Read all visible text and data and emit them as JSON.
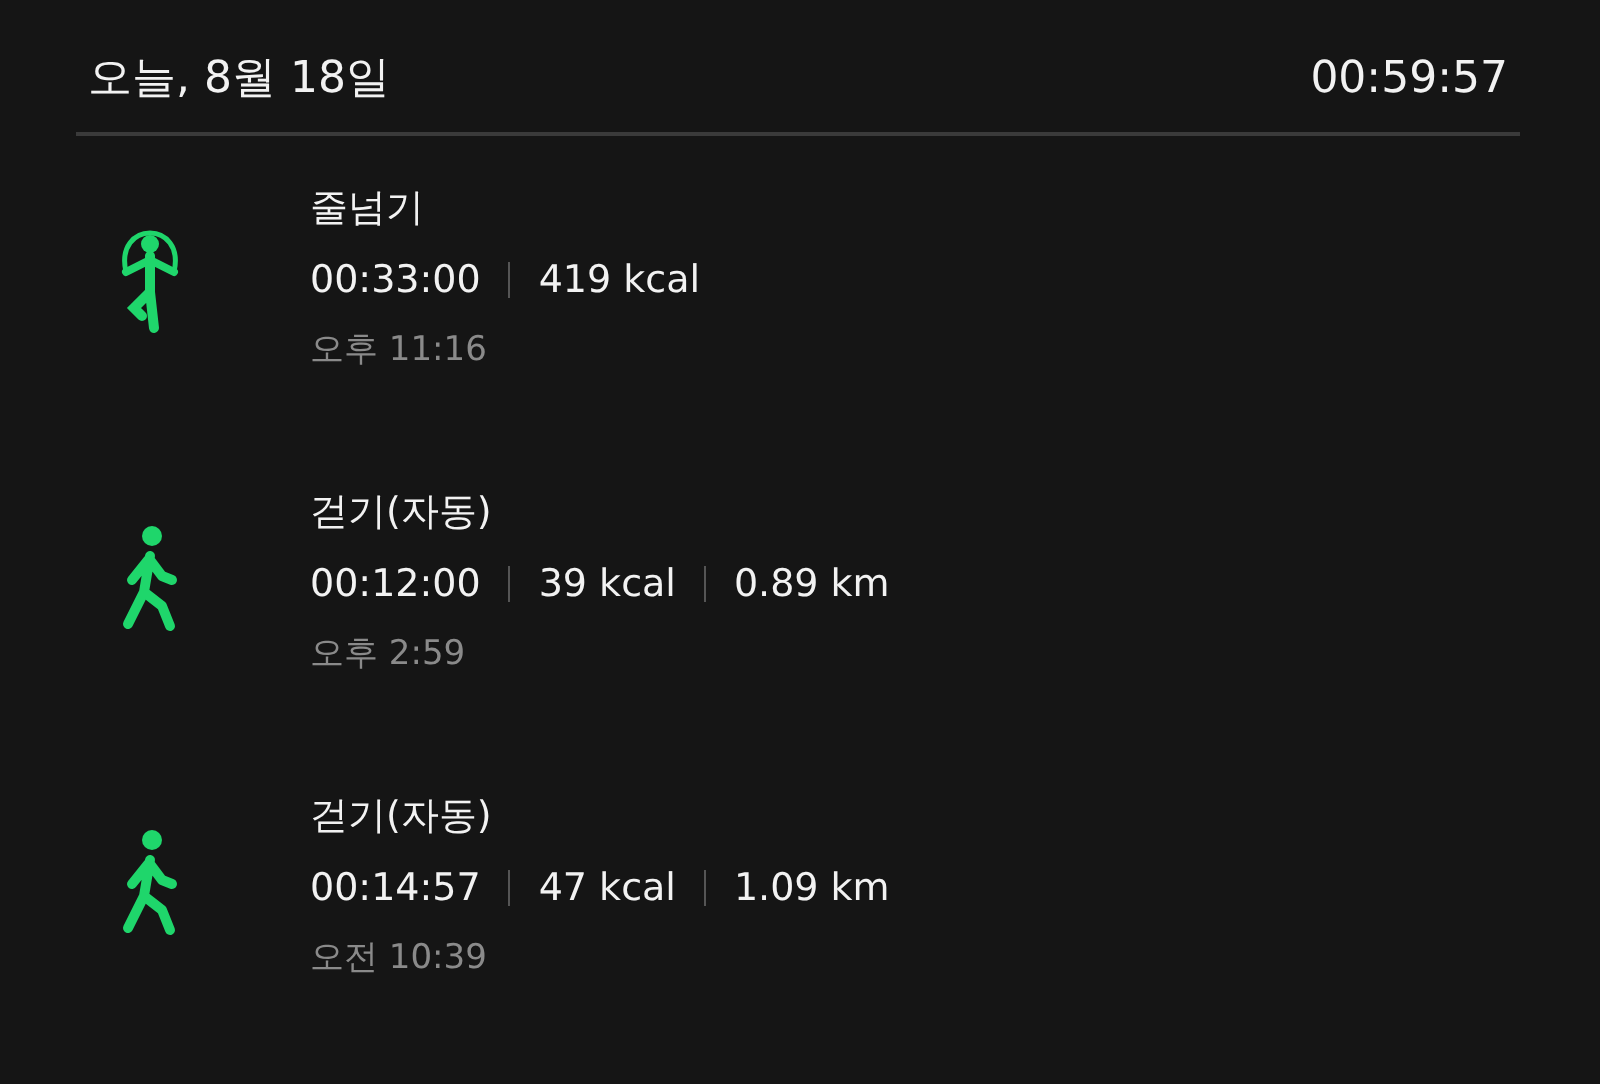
{
  "header": {
    "date": "오늘, 8월 18일",
    "total": "00:59:57"
  },
  "activities": [
    {
      "kind": "jump_rope",
      "name": "줄넘기",
      "stats": [
        "00:33:00",
        "419 kcal"
      ],
      "time": "오후 11:16"
    },
    {
      "kind": "walking",
      "name": "걷기(자동)",
      "stats": [
        "00:12:00",
        "39 kcal",
        "0.89 km"
      ],
      "time": "오후 2:59"
    },
    {
      "kind": "walking",
      "name": "걷기(자동)",
      "stats": [
        "00:14:57",
        "47 kcal",
        "1.09 km"
      ],
      "time": "오전 10:39"
    }
  ]
}
